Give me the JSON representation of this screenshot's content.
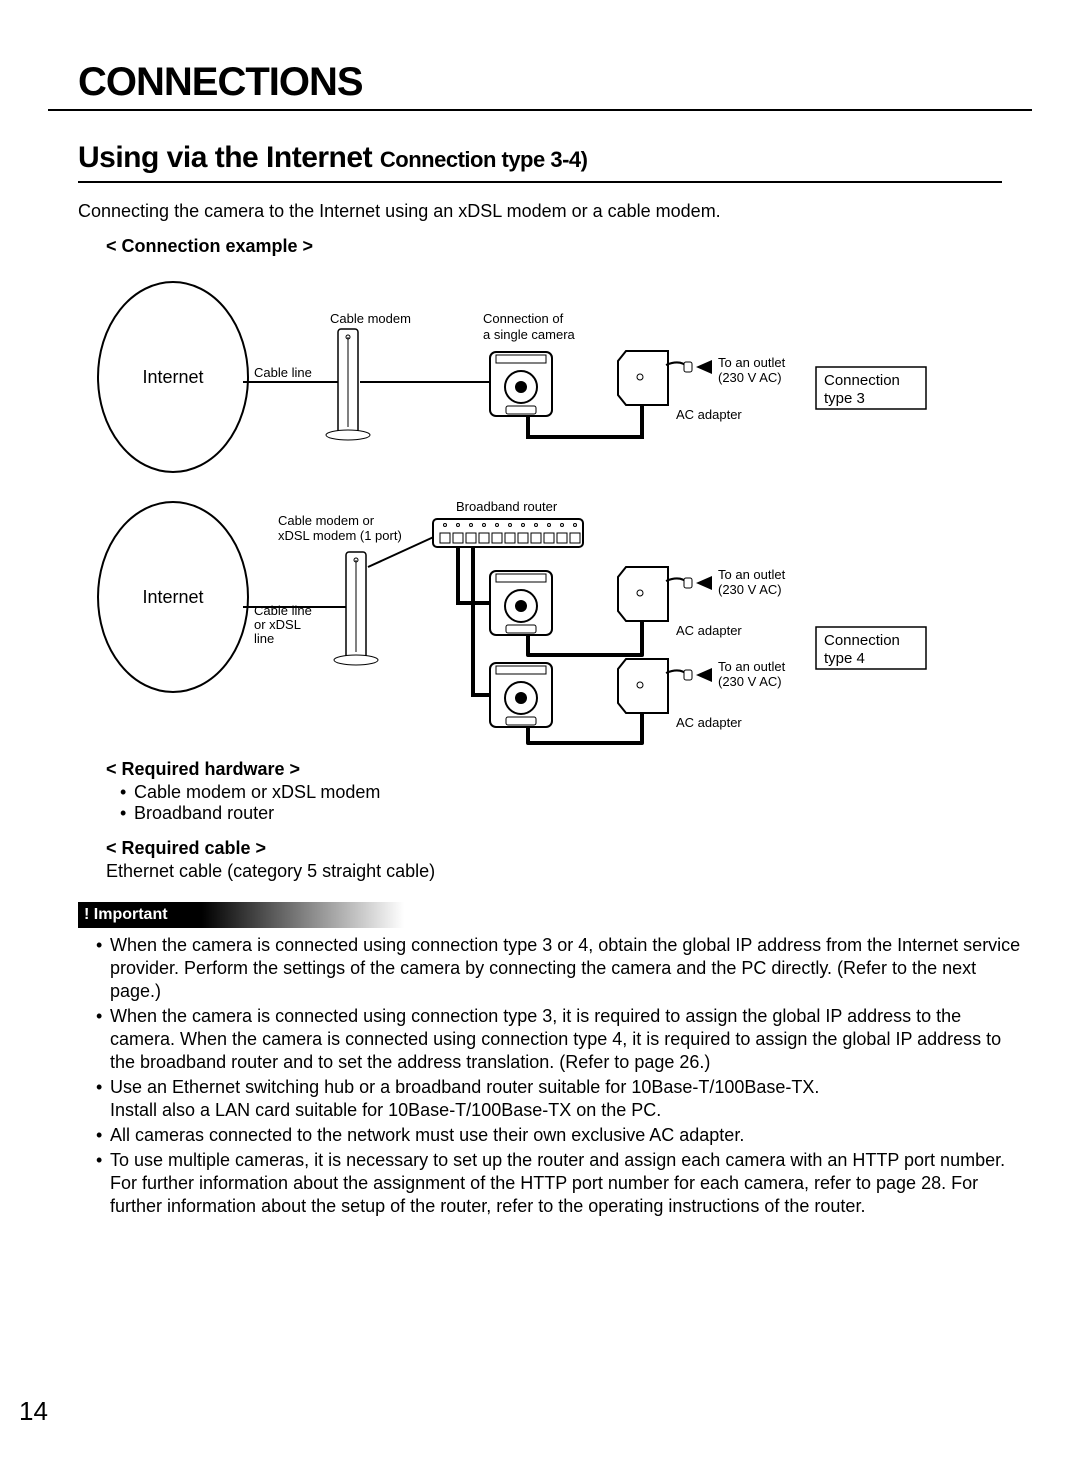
{
  "page_number": "14",
  "heading1": "CONNECTIONS",
  "heading2_main": "Using via the Internet ",
  "heading2_sub": "Connection type 3-4)",
  "intro": "Connecting the camera to the Internet using an xDSL modem or a cable modem.",
  "example_label": "< Connection example >",
  "diagram": {
    "internet": "Internet",
    "cable_line": "Cable line",
    "cable_modem": "Cable modem",
    "single_camera": {
      "l1": "Connection of",
      "l2": "a single camera"
    },
    "to_outlet": {
      "l1": "To an outlet",
      "l2": "(230 V AC)"
    },
    "ac_adapter": "AC adapter",
    "conn3": {
      "l1": "Connection",
      "l2": "type 3"
    },
    "conn4": {
      "l1": "Connection",
      "l2": "type 4"
    },
    "broadband_router": "Broadband router",
    "modem1p": {
      "l1": "Cable modem or",
      "l2": "xDSL modem (1 port)"
    },
    "cable_xdsl": {
      "l1": "Cable line",
      "l2": "or xDSL",
      "l3": "line"
    }
  },
  "req_hw_h": "< Required hardware >",
  "req_hw": [
    "Cable modem or xDSL modem",
    "Broadband router"
  ],
  "req_cable_h": "< Required cable >",
  "req_cable": "Ethernet cable (category 5 straight cable)",
  "important_label": "! Important",
  "important": [
    "When the camera is connected using connection type 3 or 4, obtain the global IP address from the Internet service provider. Perform the settings of the camera by connecting the camera and the PC directly. (Refer to the next page.)",
    "When the camera is connected using connection type 3, it is required to assign the global IP address to the camera. When the camera is connected using connection type 4, it is required to assign the global IP address to the broadband router and to set the address translation. (Refer to page 26.)",
    "Use an Ethernet switching hub or a broadband router suitable for 10Base-T/100Base-TX.\nInstall also a LAN card suitable for 10Base-T/100Base-TX on the PC.",
    "All cameras connected to the network must use their own exclusive AC adapter.",
    "To use multiple cameras, it is necessary to set up the router and assign each camera with an HTTP port number. For further information about the assignment of the HTTP port number for each camera, refer to page 28. For further information about the setup of the router, refer to the operating instructions of the router."
  ]
}
